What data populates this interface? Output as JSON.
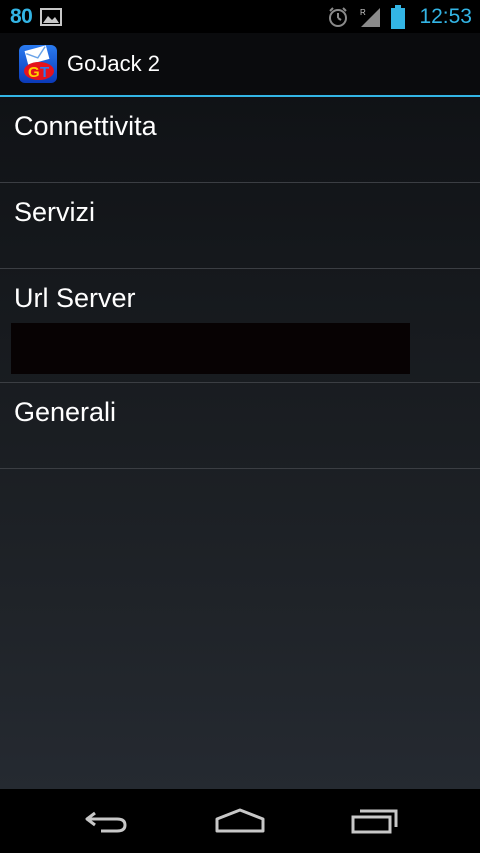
{
  "status_bar": {
    "battery_percent": "80",
    "time": "12:53",
    "icons": [
      "gallery-icon",
      "alarm-icon",
      "signal-icon",
      "battery-icon"
    ],
    "accent_color": "#33b5e5"
  },
  "action_bar": {
    "app_title": "GoJack 2",
    "app_icon": "gojack-app-icon",
    "divider_color": "#33b5e5"
  },
  "preferences": {
    "items": [
      {
        "label": "Connettivita"
      },
      {
        "label": "Servizi"
      },
      {
        "label": "Url Server",
        "input_value": "",
        "input_placeholder": ""
      },
      {
        "label": "Generali"
      }
    ]
  },
  "nav_bar": {
    "icons": [
      "back-icon",
      "home-icon",
      "recents-icon"
    ]
  }
}
